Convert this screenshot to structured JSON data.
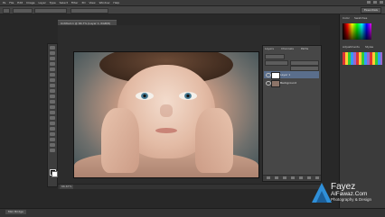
{
  "menu": [
    "Ps",
    "File",
    "Edit",
    "Image",
    "Layer",
    "Type",
    "Select",
    "Filter",
    "3D",
    "View",
    "Window",
    "Help"
  ],
  "options_bar": {
    "workspace": "Essentials"
  },
  "document": {
    "tab_title": "Untitled-1 @ 66.7% (Layer 1, RGB/8)",
    "zoom": "66.67%"
  },
  "layers_panel": {
    "tabs": [
      "Layers",
      "Channels",
      "Paths"
    ],
    "layers": [
      {
        "name": "Layer 1",
        "selected": true
      },
      {
        "name": "Background",
        "selected": false
      }
    ]
  },
  "right_panel": {
    "tabs": [
      "Color",
      "Swatches",
      "Adjustments",
      "Styles"
    ]
  },
  "branding": {
    "name": "Fayez",
    "site": "AlFawaz.Com",
    "tagline": "Photography & Design",
    "logo_color": "#2f8fd8"
  },
  "bottom_bar": {
    "tab": "Mini Bridge"
  }
}
